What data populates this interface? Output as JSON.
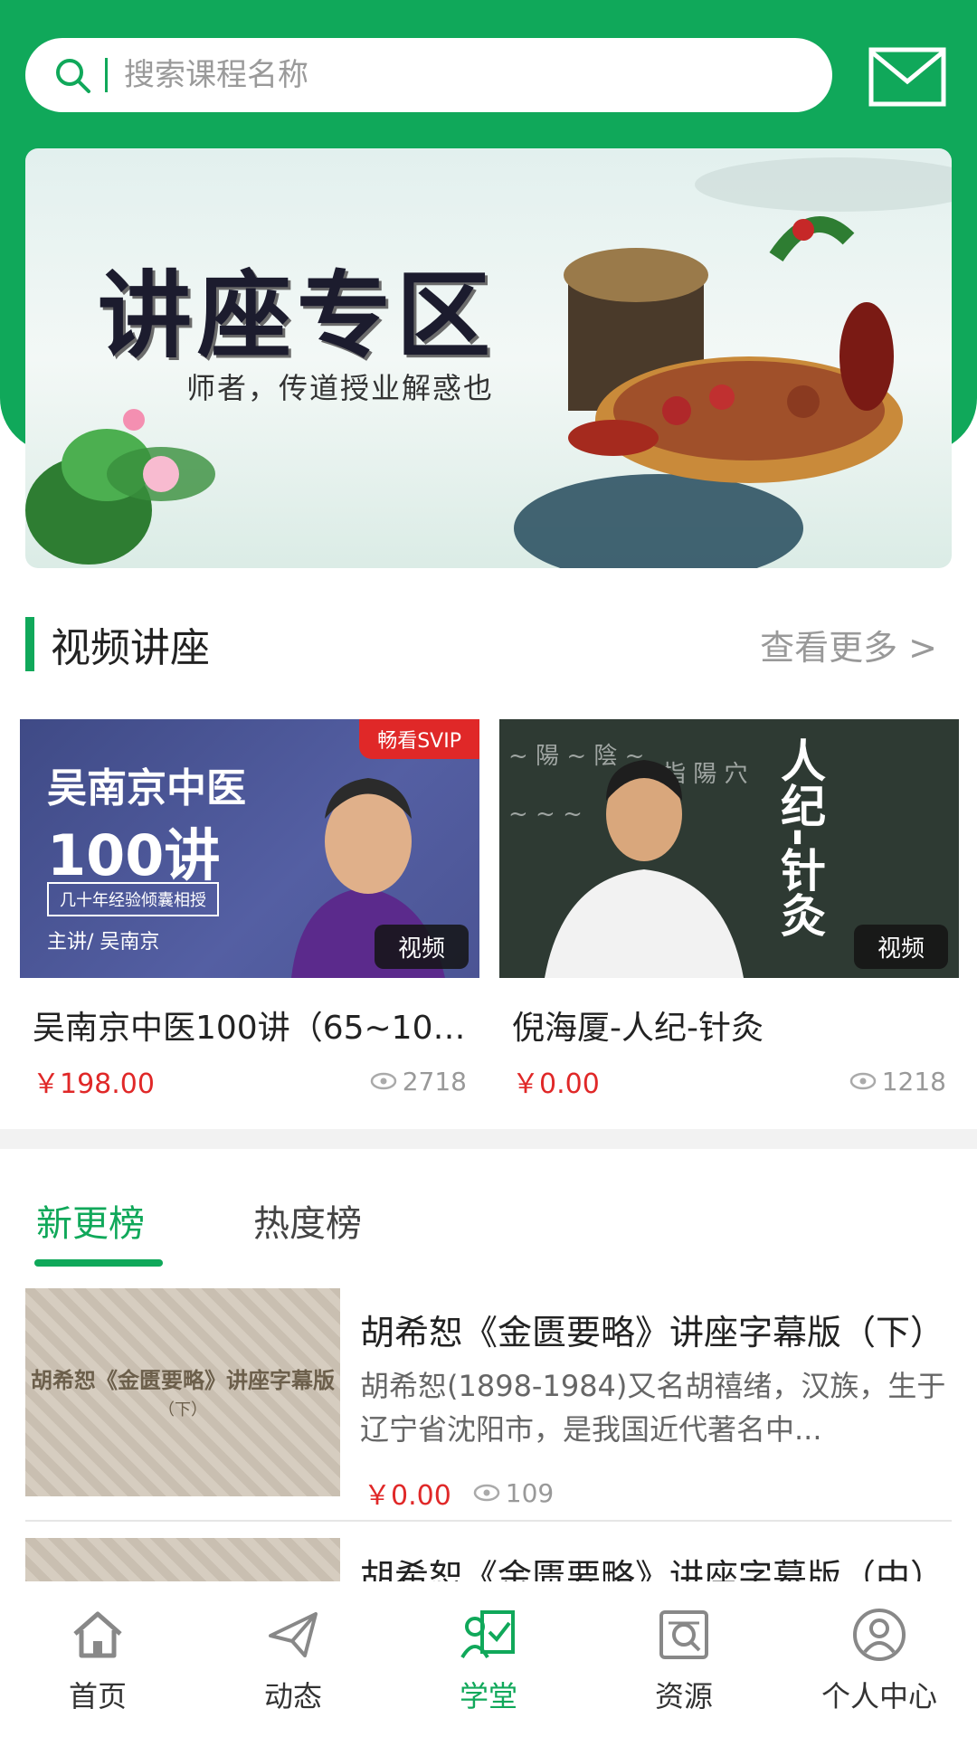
{
  "colors": {
    "brand": "#10a85a",
    "price": "#e02828",
    "muted": "#999999"
  },
  "header": {
    "search_placeholder": "搜索课程名称",
    "search_icon": "search-icon",
    "mail_icon": "mail-icon"
  },
  "banner": {
    "title": "讲座专区",
    "subtitle": "师者，传道授业解惑也"
  },
  "video_section": {
    "title": "视频讲座",
    "more": "查看更多 >",
    "courses": [
      {
        "name": "吴南京中医100讲（65~10…",
        "price": "￥198.00",
        "views": "2718",
        "badge": "畅看SVIP",
        "type": "视频",
        "thumb_title": "吴南京中医",
        "thumb_num": "100讲",
        "thumb_sub": "几十年经验倾囊相授",
        "thumb_lecturer": "主讲/ 吴南京"
      },
      {
        "name": "倪海厦-人纪-针灸",
        "price": "￥0.00",
        "views": "1218",
        "type": "视频",
        "thumb_text": "人纪-针灸"
      }
    ]
  },
  "tabs": {
    "new": "新更榜",
    "hot": "热度榜"
  },
  "list": [
    {
      "title": "胡希恕《金匮要略》讲座字幕版（下）",
      "desc": "胡希恕(1898-1984)又名胡禧绪，汉族，生于辽宁省沈阳市，是我国近代著名中...",
      "price": "￥0.00",
      "views": "109",
      "thumb_title": "胡希恕《金匮要略》讲座字幕版",
      "thumb_note": "（下）"
    },
    {
      "title": "胡希恕《金匮要略》讲座字幕版（中）"
    }
  ],
  "nav": [
    {
      "label": "首页",
      "icon": "home-icon"
    },
    {
      "label": "动态",
      "icon": "paper-plane-icon"
    },
    {
      "label": "学堂",
      "icon": "study-icon",
      "active": true
    },
    {
      "label": "资源",
      "icon": "resource-search-icon"
    },
    {
      "label": "个人中心",
      "icon": "user-icon"
    }
  ]
}
